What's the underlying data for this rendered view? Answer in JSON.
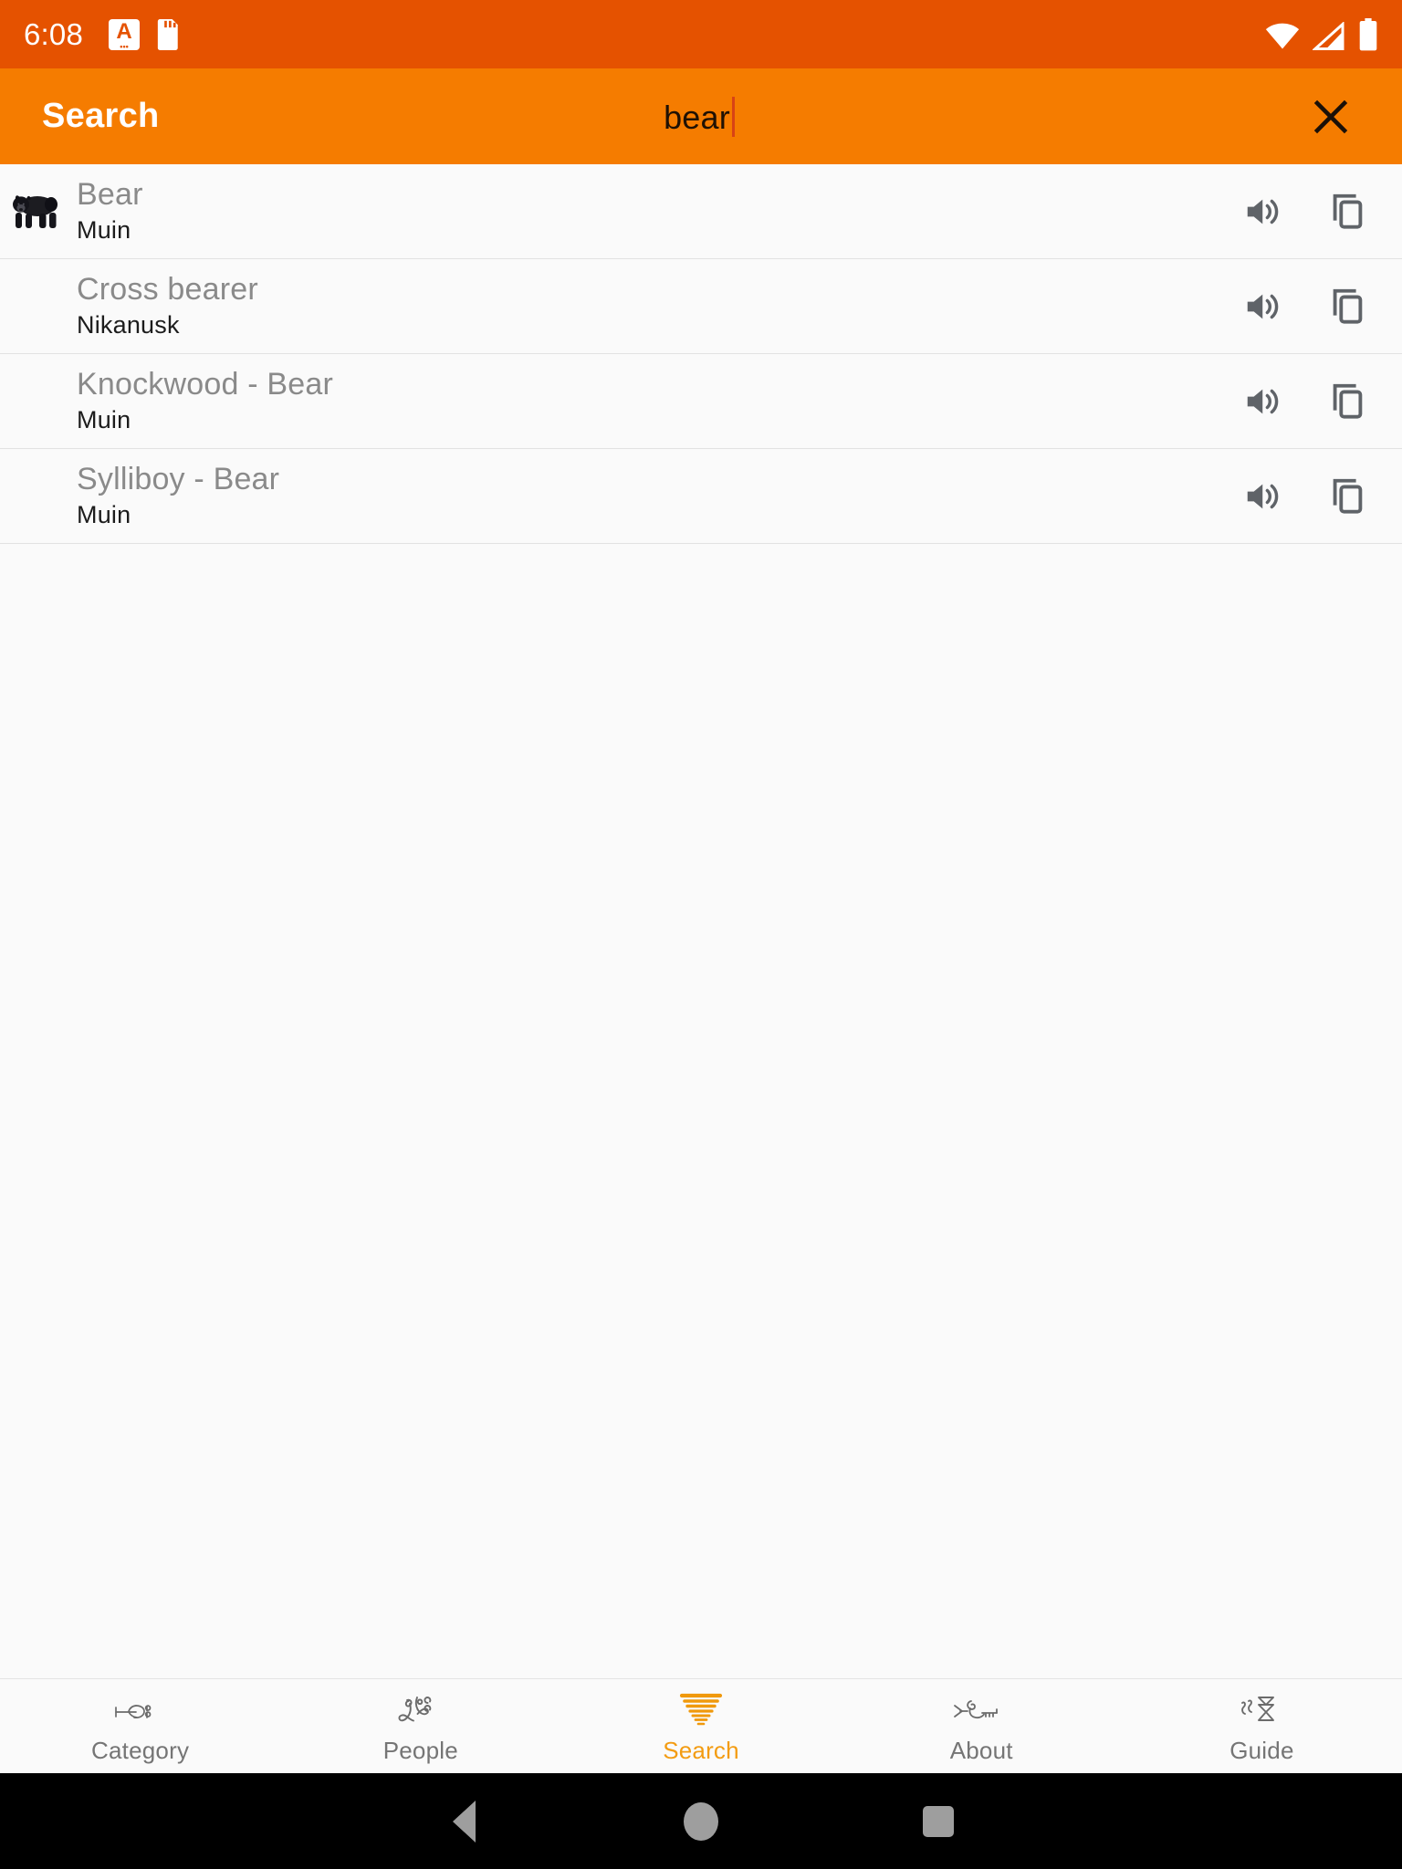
{
  "status_bar": {
    "time": "6:08",
    "left_icons": [
      "aod-letter-a-icon",
      "sd-card-icon"
    ],
    "right_icons": [
      "wifi-icon",
      "cellular-signal-icon",
      "battery-icon"
    ],
    "background_color": "#e55200"
  },
  "toolbar": {
    "title": "Search",
    "background_color": "#f57c00",
    "search_value": "bear",
    "search_placeholder": "Search",
    "close_label": "✕"
  },
  "results": [
    {
      "title": "Bear",
      "subtitle": "Muin",
      "thumbnail": "black-bear-photo",
      "has_thumbnail": true,
      "play_icon": "volume-speaker-icon",
      "copy_icon": "copy-icon"
    },
    {
      "title": "Cross bearer",
      "subtitle": "Nikanusk",
      "thumbnail": "",
      "has_thumbnail": false,
      "play_icon": "volume-speaker-icon",
      "copy_icon": "copy-icon"
    },
    {
      "title": "Knockwood - Bear",
      "subtitle": "Muin",
      "thumbnail": "",
      "has_thumbnail": false,
      "play_icon": "volume-speaker-icon",
      "copy_icon": "copy-icon"
    },
    {
      "title": "Sylliboy - Bear",
      "subtitle": "Muin",
      "thumbnail": "",
      "has_thumbnail": false,
      "play_icon": "volume-speaker-icon",
      "copy_icon": "copy-icon"
    }
  ],
  "bottom_nav": {
    "active_color": "#f39c12",
    "inactive_color": "#757575",
    "items": [
      {
        "label": "Category",
        "icon": "mikmaq-glyph-category-icon",
        "active": false
      },
      {
        "label": "People",
        "icon": "mikmaq-glyph-people-icon",
        "active": false
      },
      {
        "label": "Search",
        "icon": "mikmaq-glyph-search-icon",
        "active": true
      },
      {
        "label": "About",
        "icon": "mikmaq-glyph-about-icon",
        "active": false
      },
      {
        "label": "Guide",
        "icon": "mikmaq-glyph-guide-icon",
        "active": false
      }
    ]
  },
  "android_nav": {
    "back": "back-triangle-icon",
    "home": "home-circle-icon",
    "recents": "recents-square-icon"
  }
}
